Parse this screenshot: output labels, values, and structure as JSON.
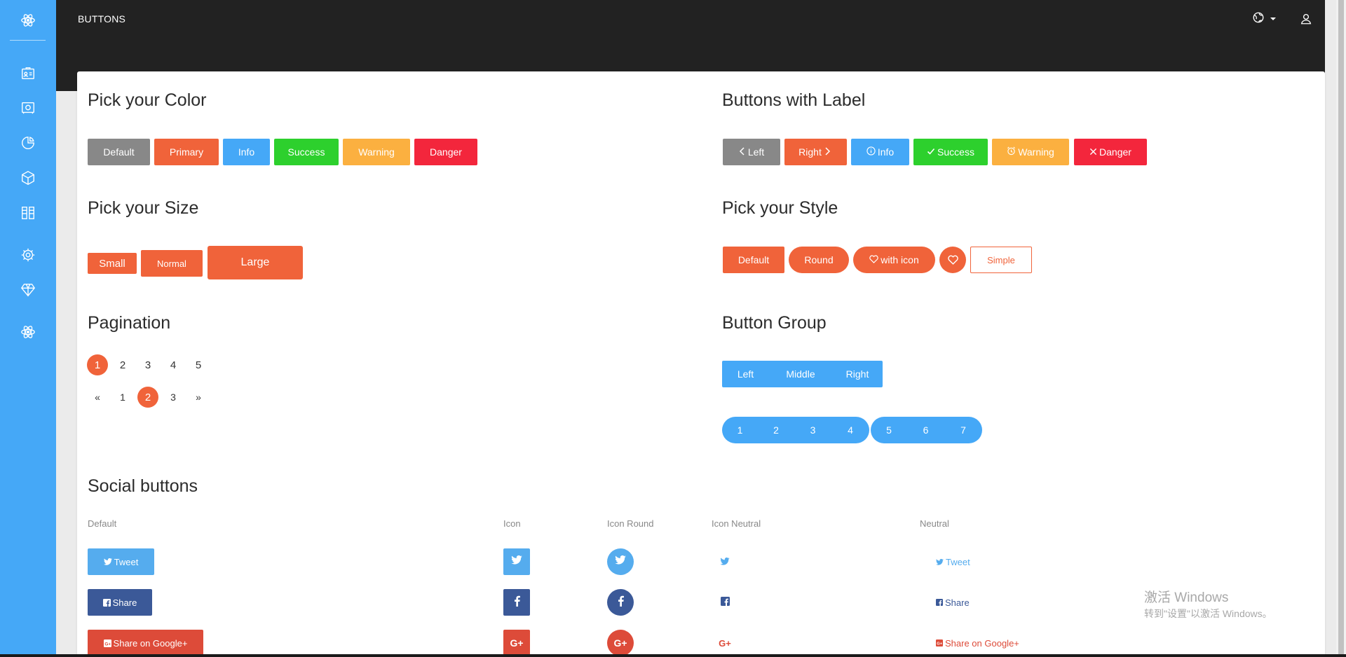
{
  "colors": {
    "sidebar": "#45a8f7",
    "topbar": "#222222",
    "default": "#888888",
    "primary": "#f0633a",
    "info": "#45a8f7",
    "success": "#2dd02d",
    "warning": "#fbb040",
    "danger": "#f3263c",
    "twitter": "#55acee",
    "facebook": "#3b5998",
    "google": "#dd4b39"
  },
  "sidebar": {
    "logo_icon": "atom-icon",
    "items": [
      {
        "icon": "id-card-icon"
      },
      {
        "icon": "vault-icon"
      },
      {
        "icon": "chart-pie-icon"
      },
      {
        "icon": "box-icon"
      },
      {
        "icon": "widgets-icon"
      },
      {
        "icon": "gear-icon"
      },
      {
        "icon": "diamond-icon"
      },
      {
        "icon": "atom-icon"
      }
    ]
  },
  "topbar": {
    "title": "BUTTONS",
    "globe_icon": "globe-icon",
    "user_icon": "user-icon"
  },
  "color_section": {
    "title": "Pick your Color",
    "buttons": [
      "Default",
      "Primary",
      "Info",
      "Success",
      "Warning",
      "Danger"
    ]
  },
  "label_section": {
    "title": "Buttons with Label",
    "buttons": [
      {
        "label": "Left",
        "icon": "chevron-left-icon"
      },
      {
        "label": "Right",
        "icon": "chevron-right-icon"
      },
      {
        "label": "Info",
        "icon": "info-circle-icon"
      },
      {
        "label": "Success",
        "icon": "check-icon"
      },
      {
        "label": "Warning",
        "icon": "alarm-icon"
      },
      {
        "label": "Danger",
        "icon": "close-icon"
      }
    ]
  },
  "size_section": {
    "title": "Pick your Size",
    "buttons": [
      "Small",
      "Normal",
      "Large"
    ]
  },
  "style_section": {
    "title": "Pick your Style",
    "buttons": [
      "Default",
      "Round",
      "with icon",
      "Simple"
    ],
    "heart_icon": "heart-icon"
  },
  "pagination_section": {
    "title": "Pagination",
    "row1": {
      "pages": [
        "1",
        "2",
        "3",
        "4",
        "5"
      ],
      "active": "1"
    },
    "row2": {
      "prev": "«",
      "pages": [
        "1",
        "2",
        "3"
      ],
      "next": "»",
      "active": "2"
    }
  },
  "group_section": {
    "title": "Button Group",
    "group1": [
      "Left",
      "Middle",
      "Right"
    ],
    "group2a": [
      "1",
      "2",
      "3",
      "4"
    ],
    "group2b": [
      "5",
      "6",
      "7"
    ]
  },
  "social_section": {
    "title": "Social buttons",
    "columns": [
      "Default",
      "Icon",
      "Icon Round",
      "Icon Neutral",
      "Neutral"
    ],
    "rows": [
      {
        "network": "twitter",
        "label": "Tweet",
        "icon": "twitter-icon"
      },
      {
        "network": "facebook",
        "label": "Share",
        "icon": "facebook-icon"
      },
      {
        "network": "google",
        "label": "Share on Google+",
        "icon": "google-plus-icon"
      }
    ]
  },
  "watermark": {
    "line1": "激活 Windows",
    "line2": "转到\"设置\"以激活 Windows。"
  }
}
